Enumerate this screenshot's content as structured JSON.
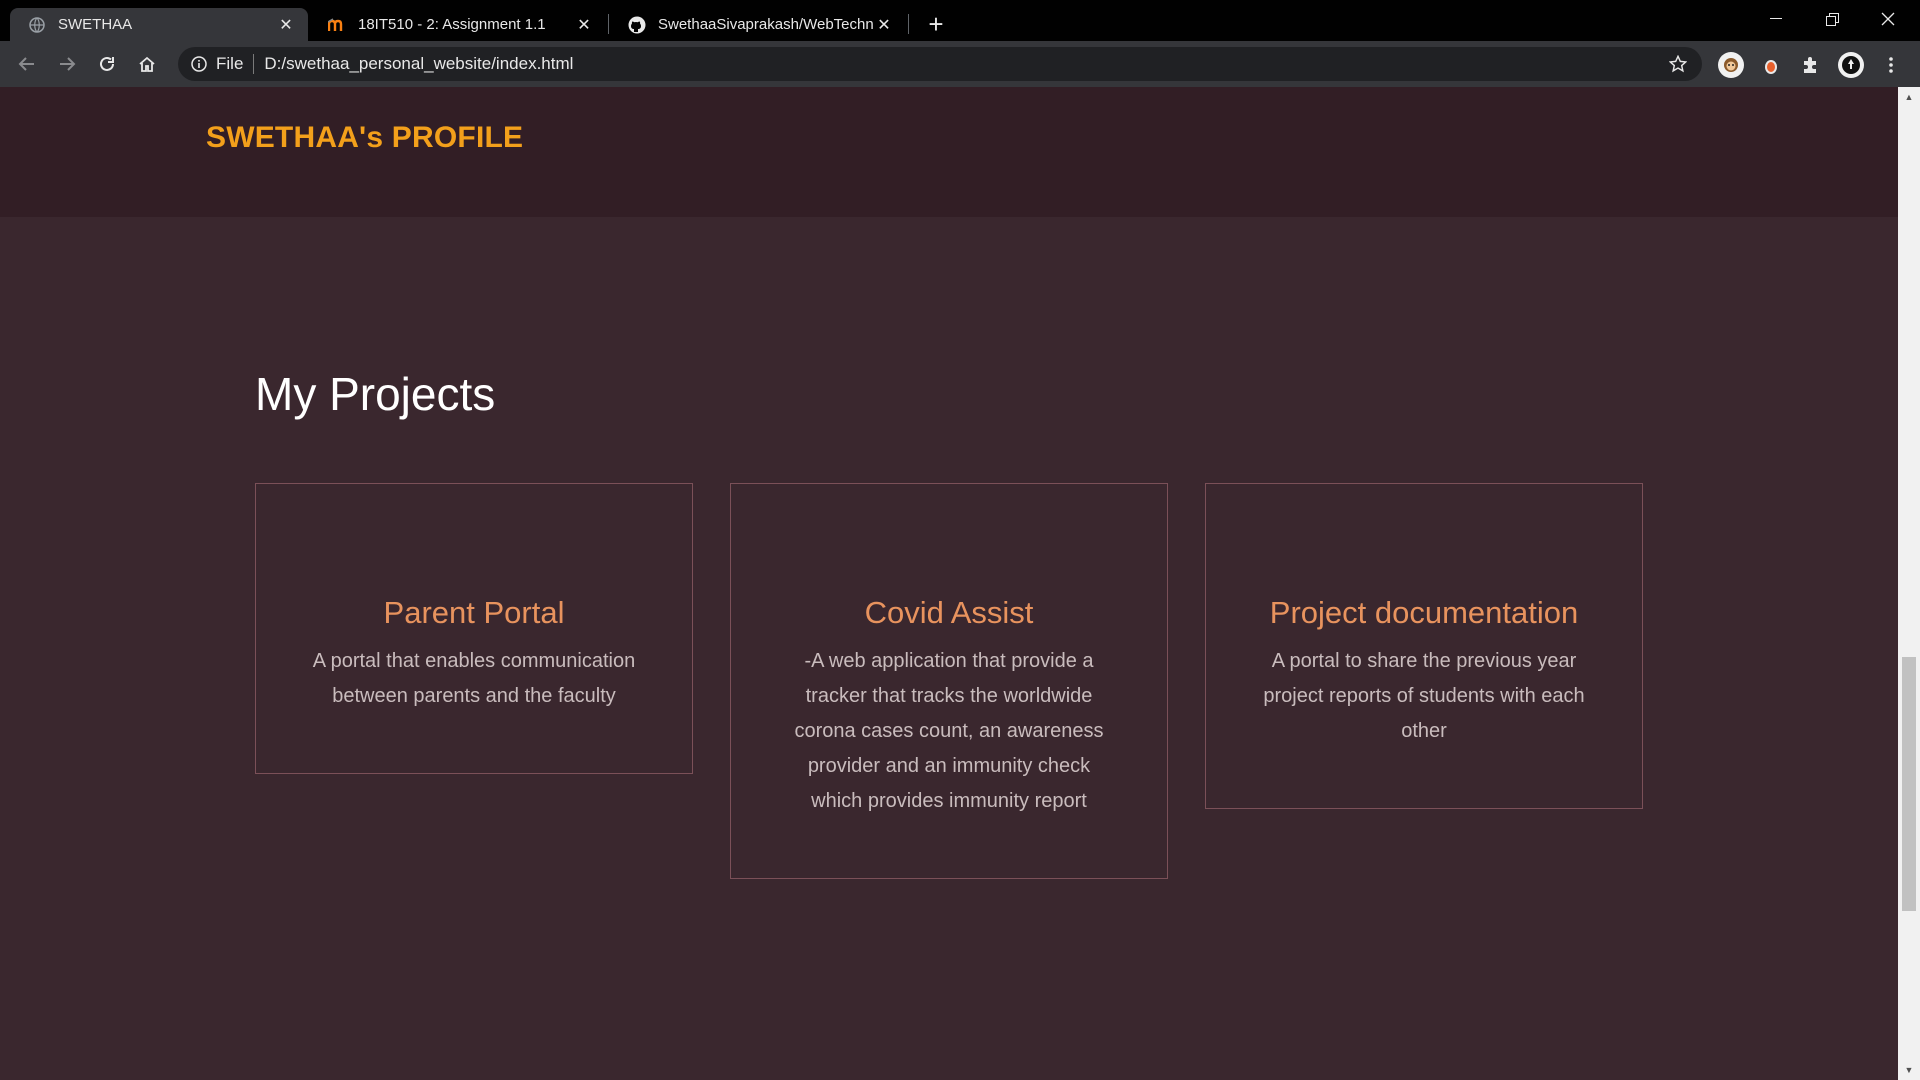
{
  "browser": {
    "tabs": [
      {
        "title": "SWETHAA",
        "icon": "globe-icon",
        "active": true
      },
      {
        "title": "18IT510 - 2: Assignment 1.1",
        "icon": "moodle-icon",
        "active": false
      },
      {
        "title": "SwethaaSivaprakash/WebTechno",
        "icon": "github-icon",
        "active": false
      }
    ],
    "new_tab": "+",
    "omnibox": {
      "scheme": "File",
      "url": "D:/swethaa_personal_website/index.html"
    }
  },
  "site": {
    "brand": "SWETHAA's PROFILE",
    "section_title": "My Projects",
    "projects": [
      {
        "title": "Parent Portal",
        "description": "A portal that enables communication between parents and the faculty"
      },
      {
        "title": "Covid Assist",
        "description": "-A web application that provide a tracker that tracks the worldwide corona cases count, an awareness provider and an immunity check which provides immunity report"
      },
      {
        "title": "Project documentation",
        "description": "A portal to share the previous year project reports of students with each other"
      }
    ]
  },
  "colors": {
    "brand": "#f3a01b",
    "card_title": "#e8935e",
    "page_bg": "#3a272e",
    "header_bg": "#321e25"
  }
}
